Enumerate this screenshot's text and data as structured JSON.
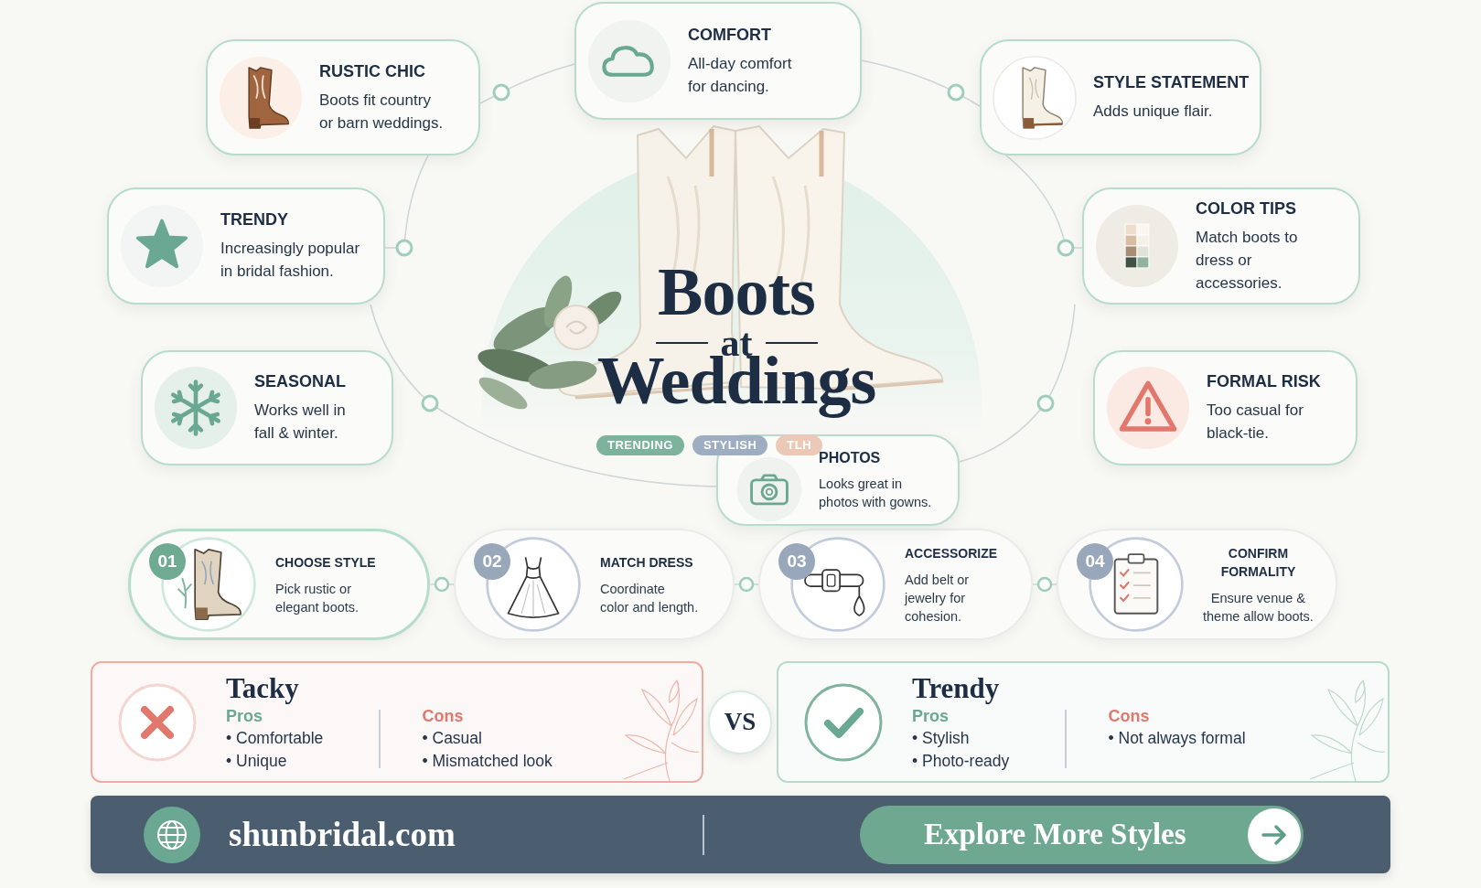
{
  "hero": {
    "title_lines": [
      "Boots",
      "at",
      "Weddings"
    ],
    "tags": [
      {
        "label": "TRENDING",
        "color": "#7db39c"
      },
      {
        "label": "STYLISH",
        "color": "#9eadc2"
      },
      {
        "label": "TLH",
        "color": "#ecc8b6"
      }
    ]
  },
  "features": [
    {
      "title": "RUSTIC CHIC",
      "text": "Boots fit country\nor barn weddings."
    },
    {
      "title": "COMFORT",
      "text": "All-day comfort\nfor dancing."
    },
    {
      "title": "STYLE STATEMENT",
      "text": "Adds unique flair."
    },
    {
      "title": "TRENDY",
      "text": "Increasingly popular\nin bridal fashion."
    },
    {
      "title": "COLOR TIPS",
      "text": "Match boots to\ndress or\naccessories."
    },
    {
      "title": "SEASONAL",
      "text": "Works well in\nfall & winter."
    },
    {
      "title": "FORMAL RISK",
      "text": "Too casual for\nblack-tie."
    },
    {
      "title": "PHOTOS",
      "text": "Looks great in\nphotos with gowns."
    }
  ],
  "steps": [
    {
      "number": "01",
      "title": "CHOOSE STYLE",
      "text": "Pick rustic or\nelegant boots.",
      "selected": true
    },
    {
      "number": "02",
      "title": "MATCH DRESS",
      "text": "Coordinate\ncolor and length.",
      "selected": false
    },
    {
      "number": "03",
      "title": "ACCESSORIZE",
      "text": "Add belt or\njewelry for\ncohesion.",
      "selected": false
    },
    {
      "number": "04",
      "title": "CONFIRM\nFORMALITY",
      "text": "Ensure venue &\ntheme allow boots.",
      "selected": false
    }
  ],
  "comparison": {
    "vs": "VS",
    "cards": [
      {
        "kind": "negative",
        "title": "Tacky",
        "pros": {
          "label": "Pros",
          "items": [
            "• Comfortable",
            "• Unique"
          ]
        },
        "cons": {
          "label": "Cons",
          "items": [
            "• Casual",
            "• Mismatched look"
          ]
        }
      },
      {
        "kind": "positive",
        "title": "Trendy",
        "pros": {
          "label": "Pros",
          "items": [
            "• Stylish",
            "• Photo-ready"
          ]
        },
        "cons": {
          "label": "Cons",
          "items": [
            "• Not always formal"
          ]
        }
      }
    ]
  },
  "footer": {
    "site": "shunbridal.com",
    "button": "Explore More Styles"
  }
}
